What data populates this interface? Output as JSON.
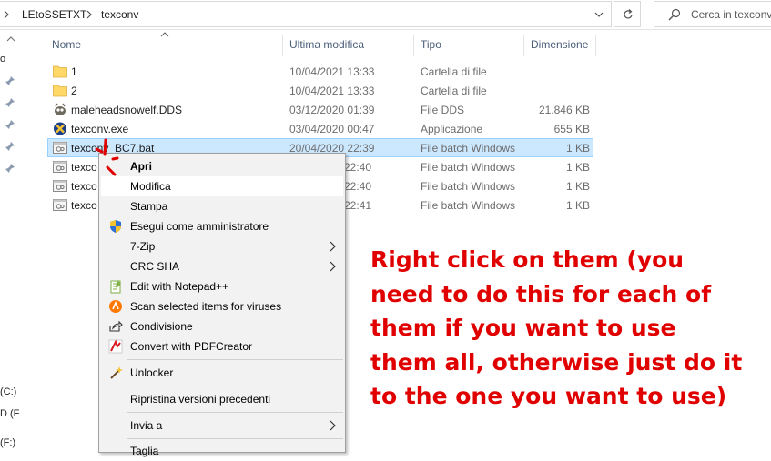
{
  "addressbar": {
    "breadcrumbs": [
      "LEtoSSETXT",
      "texconv"
    ],
    "search_placeholder": "Cerca in texconv"
  },
  "nav": {
    "partial_texts": [
      "o",
      "(C:)",
      "D (F",
      "(F:)"
    ]
  },
  "columns": {
    "name": "Nome",
    "modified": "Ultima modifica",
    "type": "Tipo",
    "size": "Dimensione"
  },
  "files": [
    {
      "name": "1",
      "modified": "10/04/2021 13:33",
      "type": "Cartella di file",
      "size": "",
      "icon": "folder-icon"
    },
    {
      "name": "2",
      "modified": "10/04/2021 13:33",
      "type": "Cartella di file",
      "size": "",
      "icon": "folder-icon"
    },
    {
      "name": "maleheadsnowelf.DDS",
      "modified": "03/12/2020 01:39",
      "type": "File DDS",
      "size": "21.846 KB",
      "icon": "gimp-icon"
    },
    {
      "name": "texconv.exe",
      "modified": "03/04/2020 00:47",
      "type": "Applicazione",
      "size": "655 KB",
      "icon": "exe-icon"
    },
    {
      "name": "texconv_BC7.bat",
      "modified": "20/04/2020 22:39",
      "type": "File batch Windows",
      "size": "1 KB",
      "icon": "batch-file-icon",
      "selected": true
    },
    {
      "name": "texco",
      "modified": "22:40",
      "type": "File batch Windows",
      "size": "1 KB",
      "icon": "batch-file-icon"
    },
    {
      "name": "texco",
      "modified": "22:40",
      "type": "File batch Windows",
      "size": "1 KB",
      "icon": "batch-file-icon"
    },
    {
      "name": "texco",
      "modified": "22:41",
      "type": "File batch Windows",
      "size": "1 KB",
      "icon": "batch-file-icon"
    }
  ],
  "context_menu": {
    "items": [
      {
        "label": "Apri",
        "bold": true
      },
      {
        "label": "Modifica",
        "hover": true
      },
      {
        "label": "Stampa"
      },
      {
        "label": "Esegui come amministratore",
        "icon": "uac-shield-icon"
      },
      {
        "label": "7-Zip",
        "submenu": true
      },
      {
        "label": "CRC SHA",
        "submenu": true
      },
      {
        "label": "Edit with Notepad++",
        "icon": "notepadpp-icon"
      },
      {
        "label": "Scan selected items for viruses",
        "icon": "avast-icon"
      },
      {
        "label": "Condivisione",
        "icon": "share-icon"
      },
      {
        "label": "Convert with PDFCreator",
        "icon": "pdfcreator-icon"
      },
      {
        "label": "Unlocker",
        "icon": "unlocker-wand-icon"
      },
      {
        "label": "Ripristina versioni precedenti"
      },
      {
        "label": "Invia a",
        "submenu": true
      },
      {
        "label": "Taglia"
      }
    ]
  },
  "annotation": {
    "lines": [
      "Right click on them (you",
      "need to do this for each of",
      "them if you want to use",
      "them all, otherwise just do it",
      "to the one you want to use)"
    ],
    "color": "#e00000"
  },
  "colors": {
    "selection_bg": "#cce8ff",
    "selection_border": "#99d1ff",
    "header_text": "#4c607a"
  }
}
